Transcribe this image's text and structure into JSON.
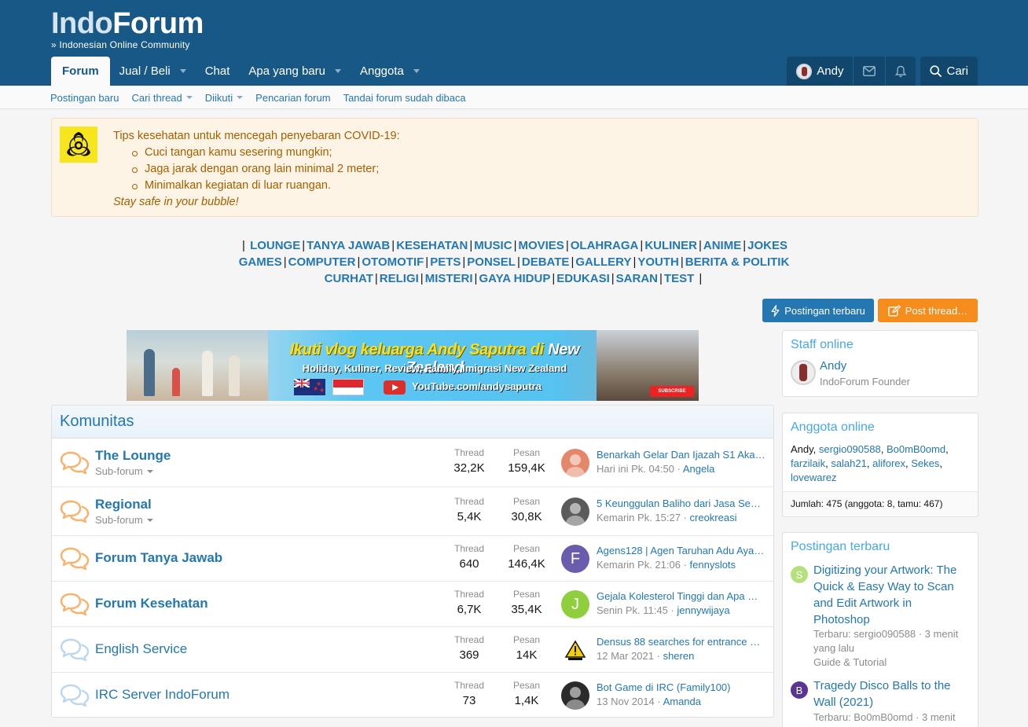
{
  "header": {
    "logo": {
      "part1": "Indo",
      "part2": "Forum",
      "tagline": "» Indonesian Online Community"
    },
    "nav": [
      {
        "label": "Forum",
        "active": true,
        "dropdown": false
      },
      {
        "label": "Jual / Beli",
        "dropdown": true
      },
      {
        "label": "Chat",
        "dropdown": false
      },
      {
        "label": "Apa yang baru",
        "dropdown": true
      },
      {
        "label": "Anggota",
        "dropdown": true
      }
    ],
    "user": {
      "name": "Andy"
    },
    "search_label": "Cari",
    "icons": [
      "envelope-icon",
      "bell-icon",
      "search-icon"
    ]
  },
  "subnav": {
    "items": [
      {
        "label": "Postingan baru",
        "dropdown": false
      },
      {
        "label": "Cari thread",
        "dropdown": true
      },
      {
        "label": "Diikuti",
        "dropdown": true
      },
      {
        "label": "Pencarian forum",
        "dropdown": false
      },
      {
        "label": "Tandai forum sudah dibaca",
        "dropdown": false
      }
    ]
  },
  "notice": {
    "heading": "Tips kesehatan untuk mencegah penyebaran COVID-19:",
    "tips": [
      "Cuci tangan kamu sesering mungkin;",
      "Jaga jarak dengan orang lain minimal 2 meter;",
      "Minimalkan kegiatan di luar ruangan."
    ],
    "closing": "Stay safe in your bubble!",
    "icon": "biohazard-icon"
  },
  "categories": {
    "lines": [
      [
        "LOUNGE",
        "TANYA JAWAB",
        "KESEHATAN",
        "MUSIC",
        "MOVIES",
        "OLAHRAGA",
        "KULINER",
        "ANIME",
        "JOKES"
      ],
      [
        "GAMES",
        "COMPUTER",
        "OTOMOTIF",
        "PETS",
        "PONSEL",
        "DEBATE",
        "GALLERY",
        "YOUTH",
        "BERITA & POLITIK"
      ],
      [
        "CURHAT",
        "RELIGI",
        "MISTERI",
        "GAYA HIDUP",
        "EDUKASI",
        "SARAN",
        "TEST"
      ]
    ]
  },
  "actions": {
    "latest_posts": "Postingan terbaru",
    "post_thread": "Post thread…"
  },
  "banner": {
    "title_prefix": "Ikuti vlog keluarga Andy Saputra di",
    "title_country": "New Zealand",
    "subtitle": "Holiday, Kuliner, Review, Family, Imigrasi New Zealand",
    "url": "YouTube.com/andysaputra",
    "subscribe": "SUBSCRIBE"
  },
  "komunitas": {
    "title": "Komunitas",
    "thread_label": "Thread",
    "pesan_label": "Pesan",
    "subforum_label": "Sub-forum",
    "forums": [
      {
        "name": "The Lounge",
        "bold": true,
        "has_sub": true,
        "threads": "32,2K",
        "messages": "159,4K",
        "last_title": "Benarkah Gelar Dan Ijazah S1 Aka…",
        "last_time": "Hari ini Pk. 04:50",
        "last_user": "Angela",
        "avatar_color": "#e4876a",
        "avatar_letter": "",
        "new": true
      },
      {
        "name": "Regional",
        "bold": true,
        "has_sub": true,
        "threads": "5,4K",
        "messages": "30,8K",
        "last_title": "5 Keunggulan Baliho dari Jasa Se…",
        "last_time": "Kemarin Pk. 15:27",
        "last_user": "creokreasi",
        "avatar_color": "#5b5b5b",
        "avatar_letter": "",
        "new": true
      },
      {
        "name": "Forum Tanya Jawab",
        "bold": true,
        "has_sub": false,
        "threads": "640",
        "messages": "146,4K",
        "last_title": "Agens128 | Agen Taruhan Adu Aya…",
        "last_time": "Kemarin Pk. 21:06",
        "last_user": "fennyslots",
        "avatar_color": "#6a5cad",
        "avatar_letter": "F",
        "new": true
      },
      {
        "name": "Forum Kesehatan",
        "bold": true,
        "has_sub": false,
        "threads": "6,7K",
        "messages": "35,4K",
        "last_title": "Gejala Kolesterol Tinggi dan Apa …",
        "last_time": "Senin Pk. 11:45",
        "last_user": "jennywijaya",
        "avatar_color": "#8fcf3e",
        "avatar_letter": "J",
        "new": true
      },
      {
        "name": "English Service",
        "bold": false,
        "has_sub": false,
        "threads": "369",
        "messages": "14K",
        "last_title": "Densus 88 searches for entrance …",
        "last_time": "12 Mar 2021",
        "last_user": "sheren",
        "avatar_color": "#ffffff",
        "avatar_letter": "",
        "new": false
      },
      {
        "name": "IRC Server IndoForum",
        "bold": false,
        "has_sub": false,
        "threads": "73",
        "messages": "1,4K",
        "last_title": "Bot Game di IRC (Family100)",
        "last_time": "13 Nov 2014",
        "last_user": "Amanda",
        "avatar_color": "#2b2b2b",
        "avatar_letter": "",
        "new": false
      }
    ]
  },
  "sidebar": {
    "staff": {
      "title": "Staff online",
      "name": "Andy",
      "role": "IndoForum Founder"
    },
    "online": {
      "title": "Anggota online",
      "plain_first": "Andy",
      "members": [
        "sergio090588",
        "Bo0mB0omd",
        "farzilaik",
        "salah21",
        "aliforex",
        "Sekes",
        "lovewarez"
      ],
      "footer": "Jumlah: 475 (anggota: 8, tamu: 467)"
    },
    "latest": {
      "title": "Postingan terbaru",
      "posts": [
        {
          "letter": "S",
          "color": "#b6e07c",
          "title": "Digitizing your Artwork: The Quick & Easy Way to Scan and Edit Artwork in Photoshop",
          "meta": "Terbaru: sergio090588 · 3 menit yang lalu",
          "forum": "Guide & Tutorial"
        },
        {
          "letter": "B",
          "color": "#5a3593",
          "title": "Tragedy Disco Balls to the Wall (2021)",
          "meta": "Terbaru: Bo0mB0omd · 3 menit",
          "forum": ""
        }
      ]
    }
  },
  "colors": {
    "header": "#185886",
    "accent": "#2577b1",
    "orange": "#f48d1b",
    "notice": "#fef4e5",
    "notice_text": "#a25f00"
  }
}
